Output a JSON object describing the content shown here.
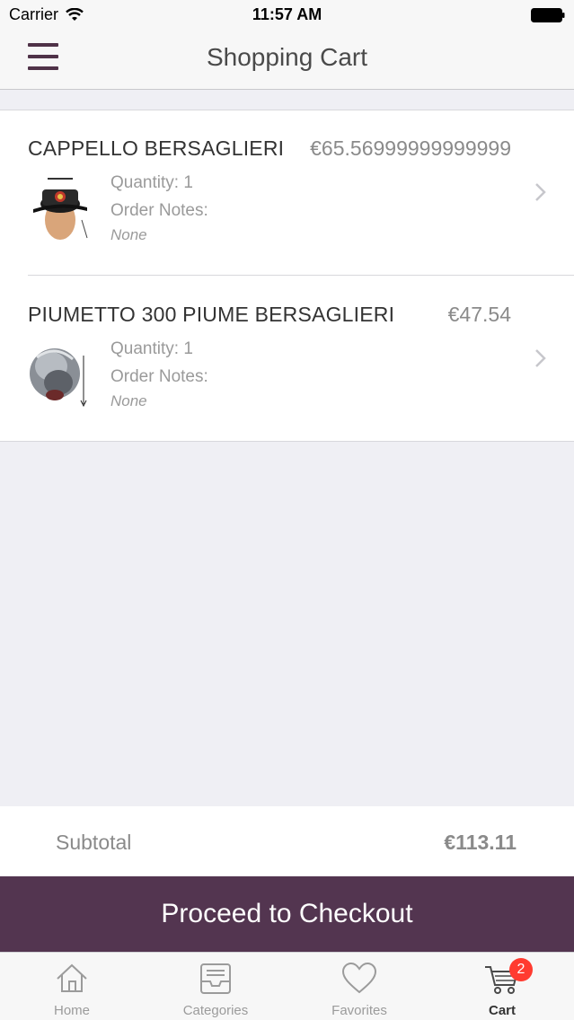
{
  "status_bar": {
    "carrier": "Carrier",
    "time": "11:57 AM"
  },
  "nav": {
    "title": "Shopping Cart"
  },
  "cart": {
    "items": [
      {
        "name": "CAPPELLO BERSAGLIERI",
        "price": "€65.56999999999999",
        "quantity": "Quantity: 1",
        "notes_label": "Order Notes:",
        "notes": "None"
      },
      {
        "name": "PIUMETTO 300 PIUME BERSAGLIERI",
        "price": "€47.54",
        "quantity": "Quantity: 1",
        "notes_label": "Order Notes:",
        "notes": "None"
      }
    ]
  },
  "subtotal": {
    "label": "Subtotal",
    "value": "€113.11"
  },
  "checkout": {
    "label": "Proceed to Checkout"
  },
  "tabs": [
    {
      "label": "Home",
      "icon": "home-icon"
    },
    {
      "label": "Categories",
      "icon": "inbox-icon"
    },
    {
      "label": "Favorites",
      "icon": "heart-icon"
    },
    {
      "label": "Cart",
      "icon": "cart-icon",
      "badge": "2"
    }
  ],
  "colors": {
    "accent": "#533550",
    "badge": "#ff3b30",
    "background": "#efeff4"
  }
}
